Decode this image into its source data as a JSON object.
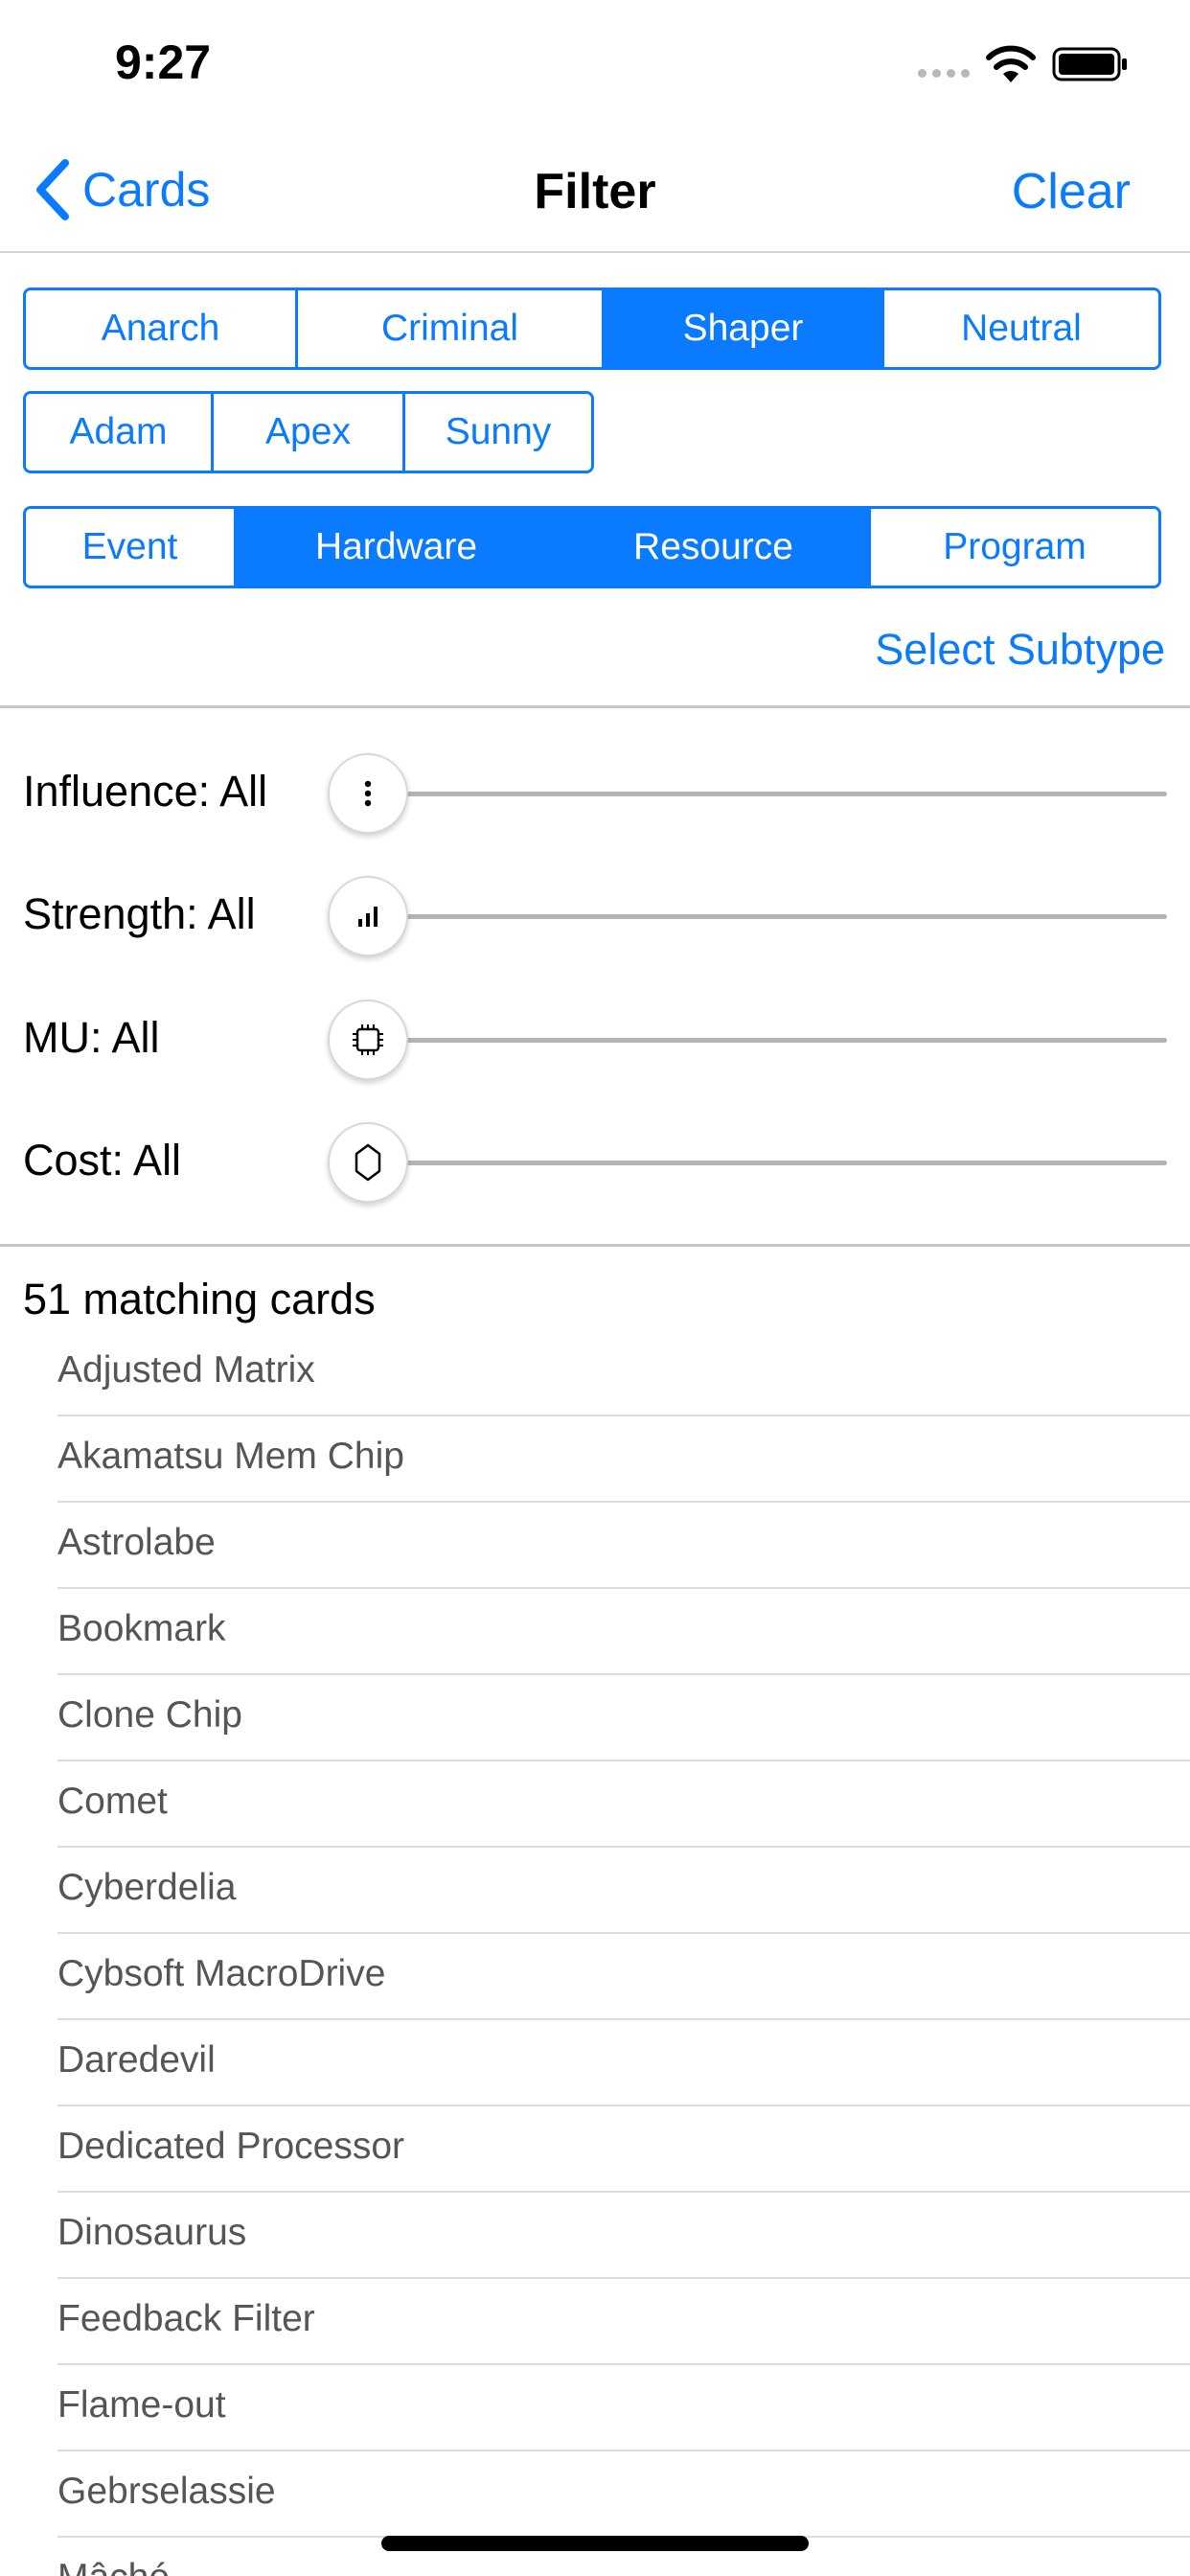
{
  "status_bar": {
    "time": "9:27"
  },
  "nav": {
    "back_label": "Cards",
    "title": "Filter",
    "clear_label": "Clear"
  },
  "factions": [
    {
      "label": "Anarch",
      "selected": false
    },
    {
      "label": "Criminal",
      "selected": false
    },
    {
      "label": "Shaper",
      "selected": true
    },
    {
      "label": "Neutral",
      "selected": false
    }
  ],
  "identities": [
    {
      "label": "Adam",
      "selected": false
    },
    {
      "label": "Apex",
      "selected": false
    },
    {
      "label": "Sunny",
      "selected": false
    }
  ],
  "card_types": [
    {
      "label": "Event",
      "selected": false
    },
    {
      "label": "Hardware",
      "selected": true
    },
    {
      "label": "Resource",
      "selected": true
    },
    {
      "label": "Program",
      "selected": false
    }
  ],
  "select_subtype_label": "Select Subtype",
  "sliders": [
    {
      "label": "Influence: All",
      "icon": "influence-icon",
      "value": 0
    },
    {
      "label": "Strength: All",
      "icon": "strength-icon",
      "value": 0
    },
    {
      "label": "MU: All",
      "icon": "mu-chip-icon",
      "value": 0
    },
    {
      "label": "Cost: All",
      "icon": "credit-icon",
      "value": 0
    }
  ],
  "results": {
    "count_label": "51 matching cards",
    "cards": [
      "Adjusted Matrix",
      "Akamatsu Mem Chip",
      "Astrolabe",
      "Bookmark",
      "Clone Chip",
      "Comet",
      "Cyberdelia",
      "Cybsoft MacroDrive",
      "Daredevil",
      "Dedicated Processor",
      "Dinosaurus",
      "Feedback Filter",
      "Flame-out",
      "Gebrselassie",
      "Mâché"
    ]
  },
  "colors": {
    "accent": "#0a7aff",
    "separator": "#c6c6c8",
    "card_text": "#555555"
  }
}
